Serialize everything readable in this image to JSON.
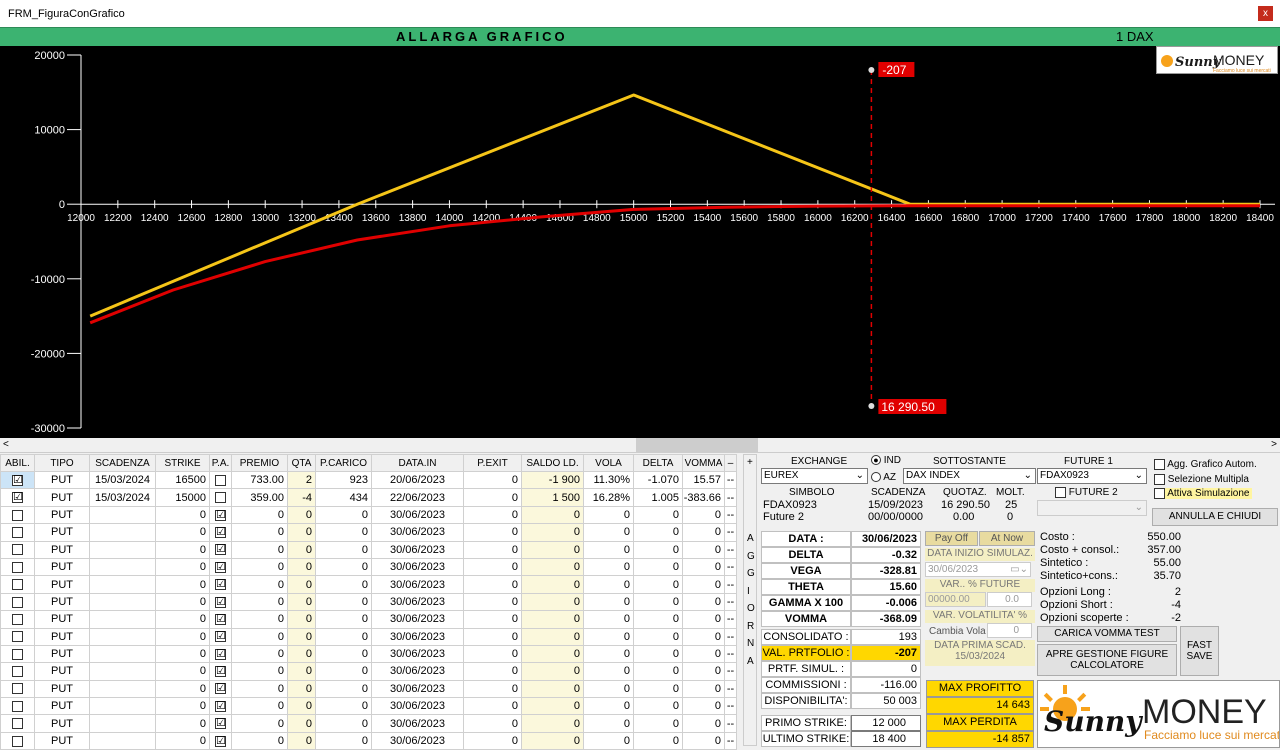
{
  "window": {
    "title": "FRM_FiguraConGrafico",
    "close": "x"
  },
  "header": {
    "title": "ALLARGA GRAFICO",
    "instrument": "1 DAX"
  },
  "logo": {
    "brand_a": "Sunny",
    "brand_b": "MONEY",
    "tagline": "Facciamo luce sui mercati"
  },
  "chart_data": {
    "type": "line",
    "xlim": [
      12000,
      18400
    ],
    "ylim": [
      -30000,
      20000
    ],
    "x_ticks": [
      "12000",
      "12200",
      "12400",
      "12600",
      "12800",
      "13000",
      "13200",
      "13400",
      "13600",
      "13800",
      "14000",
      "14200",
      "14400",
      "14600",
      "14800",
      "15000",
      "15200",
      "15400",
      "15600",
      "15800",
      "16000",
      "16200",
      "16400",
      "16600",
      "16800",
      "17000",
      "17200",
      "17400",
      "17600",
      "17800",
      "18000",
      "18200",
      "18400"
    ],
    "y_ticks": [
      "20000",
      "10000",
      "0",
      "-10000",
      "-20000",
      "-30000"
    ],
    "series": [
      {
        "color": "#f5c518",
        "x": [
          12050,
          13500,
          15000,
          16500,
          18400
        ],
        "y": [
          -15000,
          0,
          14643,
          0,
          0
        ]
      },
      {
        "color": "#e00000",
        "x": [
          12050,
          12500,
          13000,
          13500,
          14000,
          14500,
          15000,
          15500,
          16000,
          16500,
          17000,
          18400
        ],
        "y": [
          -15900,
          -11500,
          -7700,
          -4800,
          -2900,
          -1700,
          -700,
          -400,
          -250,
          -200,
          -200,
          -200
        ]
      }
    ],
    "cursor": {
      "x": 16290.5,
      "value_label": "-207",
      "x_label": "16 290.50"
    }
  },
  "table": {
    "headers": [
      "ABIL.",
      "TIPO",
      "SCADENZA",
      "STRIKE",
      "P.A.",
      "PREMIO",
      "QTA",
      "P.CARICO",
      "DATA.IN",
      "P.EXIT",
      "SALDO LD.",
      "VOLA",
      "DELTA",
      "VOMMA",
      "–"
    ],
    "rows": [
      {
        "abil": "☑",
        "tipo": "PUT",
        "scad": "15/03/2024",
        "strike": "16500",
        "pa": "",
        "premio": "733.00",
        "qta": "2",
        "pcar": "923",
        "datain": "20/06/2023",
        "pexit": "0",
        "saldo": "-1 900",
        "vola": "11.30%",
        "delta": "-1.070",
        "vomma": "15.57",
        "x": "--"
      },
      {
        "abil": "☑",
        "tipo": "PUT",
        "scad": "15/03/2024",
        "strike": "15000",
        "pa": "",
        "premio": "359.00",
        "qta": "-4",
        "pcar": "434",
        "datain": "22/06/2023",
        "pexit": "0",
        "saldo": "1 500",
        "vola": "16.28%",
        "delta": "1.005",
        "vomma": "-383.66",
        "x": "--"
      },
      {
        "abil": "",
        "tipo": "PUT",
        "scad": "",
        "strike": "0",
        "pa": "☑",
        "premio": "0",
        "qta": "0",
        "pcar": "0",
        "datain": "30/06/2023",
        "pexit": "0",
        "saldo": "0",
        "vola": "0",
        "delta": "0",
        "vomma": "0",
        "x": "--"
      },
      {
        "abil": "",
        "tipo": "PUT",
        "scad": "",
        "strike": "0",
        "pa": "☑",
        "premio": "0",
        "qta": "0",
        "pcar": "0",
        "datain": "30/06/2023",
        "pexit": "0",
        "saldo": "0",
        "vola": "0",
        "delta": "0",
        "vomma": "0",
        "x": "--"
      },
      {
        "abil": "",
        "tipo": "PUT",
        "scad": "",
        "strike": "0",
        "pa": "☑",
        "premio": "0",
        "qta": "0",
        "pcar": "0",
        "datain": "30/06/2023",
        "pexit": "0",
        "saldo": "0",
        "vola": "0",
        "delta": "0",
        "vomma": "0",
        "x": "--"
      },
      {
        "abil": "",
        "tipo": "PUT",
        "scad": "",
        "strike": "0",
        "pa": "☑",
        "premio": "0",
        "qta": "0",
        "pcar": "0",
        "datain": "30/06/2023",
        "pexit": "0",
        "saldo": "0",
        "vola": "0",
        "delta": "0",
        "vomma": "0",
        "x": "--"
      },
      {
        "abil": "",
        "tipo": "PUT",
        "scad": "",
        "strike": "0",
        "pa": "☑",
        "premio": "0",
        "qta": "0",
        "pcar": "0",
        "datain": "30/06/2023",
        "pexit": "0",
        "saldo": "0",
        "vola": "0",
        "delta": "0",
        "vomma": "0",
        "x": "--"
      },
      {
        "abil": "",
        "tipo": "PUT",
        "scad": "",
        "strike": "0",
        "pa": "☑",
        "premio": "0",
        "qta": "0",
        "pcar": "0",
        "datain": "30/06/2023",
        "pexit": "0",
        "saldo": "0",
        "vola": "0",
        "delta": "0",
        "vomma": "0",
        "x": "--"
      },
      {
        "abil": "",
        "tipo": "PUT",
        "scad": "",
        "strike": "0",
        "pa": "☑",
        "premio": "0",
        "qta": "0",
        "pcar": "0",
        "datain": "30/06/2023",
        "pexit": "0",
        "saldo": "0",
        "vola": "0",
        "delta": "0",
        "vomma": "0",
        "x": "--"
      },
      {
        "abil": "",
        "tipo": "PUT",
        "scad": "",
        "strike": "0",
        "pa": "☑",
        "premio": "0",
        "qta": "0",
        "pcar": "0",
        "datain": "30/06/2023",
        "pexit": "0",
        "saldo": "0",
        "vola": "0",
        "delta": "0",
        "vomma": "0",
        "x": "--"
      },
      {
        "abil": "",
        "tipo": "PUT",
        "scad": "",
        "strike": "0",
        "pa": "☑",
        "premio": "0",
        "qta": "0",
        "pcar": "0",
        "datain": "30/06/2023",
        "pexit": "0",
        "saldo": "0",
        "vola": "0",
        "delta": "0",
        "vomma": "0",
        "x": "--"
      },
      {
        "abil": "",
        "tipo": "PUT",
        "scad": "",
        "strike": "0",
        "pa": "☑",
        "premio": "0",
        "qta": "0",
        "pcar": "0",
        "datain": "30/06/2023",
        "pexit": "0",
        "saldo": "0",
        "vola": "0",
        "delta": "0",
        "vomma": "0",
        "x": "--"
      },
      {
        "abil": "",
        "tipo": "PUT",
        "scad": "",
        "strike": "0",
        "pa": "☑",
        "premio": "0",
        "qta": "0",
        "pcar": "0",
        "datain": "30/06/2023",
        "pexit": "0",
        "saldo": "0",
        "vola": "0",
        "delta": "0",
        "vomma": "0",
        "x": "--"
      },
      {
        "abil": "",
        "tipo": "PUT",
        "scad": "",
        "strike": "0",
        "pa": "☑",
        "premio": "0",
        "qta": "0",
        "pcar": "0",
        "datain": "30/06/2023",
        "pexit": "0",
        "saldo": "0",
        "vola": "0",
        "delta": "0",
        "vomma": "0",
        "x": "--"
      },
      {
        "abil": "",
        "tipo": "PUT",
        "scad": "",
        "strike": "0",
        "pa": "☑",
        "premio": "0",
        "qta": "0",
        "pcar": "0",
        "datain": "30/06/2023",
        "pexit": "0",
        "saldo": "0",
        "vola": "0",
        "delta": "0",
        "vomma": "0",
        "x": "--"
      },
      {
        "abil": "",
        "tipo": "PUT",
        "scad": "",
        "strike": "0",
        "pa": "☑",
        "premio": "0",
        "qta": "0",
        "pcar": "0",
        "datain": "30/06/2023",
        "pexit": "0",
        "saldo": "0",
        "vola": "0",
        "delta": "0",
        "vomma": "0",
        "x": "--"
      }
    ]
  },
  "aggiorna": [
    "A",
    "G",
    "G",
    "I",
    "O",
    "R",
    "N",
    "A"
  ],
  "aggiorna_plus": "+",
  "market": {
    "exchange_lbl": "EXCHANGE",
    "exchange": "EUREX",
    "ind": "IND",
    "az": "AZ",
    "sottostante_lbl": "SOTTOSTANTE",
    "sottostante": "DAX INDEX",
    "future1_lbl": "FUTURE 1",
    "future1": "FDAX0923",
    "future2_lbl": "FUTURE 2",
    "simbolo_lbl": "SIMBOLO",
    "scadenza_lbl": "SCADENZA",
    "quotaz_lbl": "QUOTAZ.",
    "molt_lbl": "MOLT.",
    "simbolo1": "FDAX0923",
    "scadenza1": "15/09/2023",
    "quotaz1": "16 290.50",
    "molt1": "25",
    "simbolo2": "Future 2",
    "scadenza2": "00/00/0000",
    "quotaz2": "0.00",
    "molt2": "0"
  },
  "options": {
    "agg_grafico": "Agg. Grafico Autom.",
    "selezione": "Selezione Multipla",
    "attiva_sim": "Attiva Simulazione",
    "annulla": "ANNULLA E CHIUDI"
  },
  "greeks": {
    "data_lbl": "DATA :",
    "data": "30/06/2023",
    "delta_lbl": "DELTA",
    "delta": "-0.32",
    "vega_lbl": "VEGA",
    "vega": "-328.81",
    "theta_lbl": "THETA",
    "theta": "15.60",
    "gamma_lbl": "GAMMA X 100",
    "gamma": "-0.006",
    "vomma_lbl": "VOMMA",
    "vomma": "-368.09"
  },
  "sim": {
    "payoff": "Pay Off",
    "atnow": "At Now",
    "data_inizio_lbl": "DATA INIZIO SIMULAZ.",
    "data_inizio": "30/06/2023",
    "var_future_lbl": "VAR.. % FUTURE",
    "var_future_val": "00000.00",
    "var_future_pct": "0.0",
    "var_vol_lbl": "VAR. VOLATILITA' %",
    "cambia_vola": "Cambia Vola",
    "cambia_vola_val": "0",
    "prima_scad_lbl": "DATA PRIMA SCAD.",
    "prima_scad": "15/03/2024"
  },
  "portfolio": {
    "consolidato_lbl": "CONSOLIDATO :",
    "consolidato": "193",
    "val_lbl": "VAL. PRTFOLIO :",
    "val": "-207",
    "prtf_sim_lbl": "PRTF. SIMUL. :",
    "prtf_sim": "0",
    "commissioni_lbl": "COMMISSIONI :",
    "commissioni": "-116.00",
    "disponibilita_lbl": "DISPONIBILITA':",
    "disponibilita": "50 003",
    "primo_lbl": "PRIMO STRIKE:",
    "primo": "12 000",
    "ultimo_lbl": "ULTIMO STRIKE:",
    "ultimo": "18 400"
  },
  "costs": {
    "costo_lbl": "Costo :",
    "costo": "550.00",
    "costo_cons_lbl": "Costo + consol.:",
    "costo_cons": "357.00",
    "sintetico_lbl": "Sintetico :",
    "sintetico": "55.00",
    "sint_cons_lbl": "Sintetico+cons.:",
    "sint_cons": "35.70",
    "long_lbl": "Opzioni Long :",
    "long": "2",
    "short_lbl": "Opzioni Short :",
    "short": "-4",
    "scoperte_lbl": "Opzioni scoperte :",
    "scoperte": "-2"
  },
  "actions": {
    "carica_vomma": "CARICA VOMMA TEST",
    "apre_gestione": "APRE GESTIONE FIGURE CALCOLATORE",
    "fast_save": "FAST SAVE",
    "max_profitto_lbl": "MAX PROFITTO",
    "max_profitto": "14 643",
    "max_perdita_lbl": "MAX PERDITA",
    "max_perdita": "-14 857"
  }
}
